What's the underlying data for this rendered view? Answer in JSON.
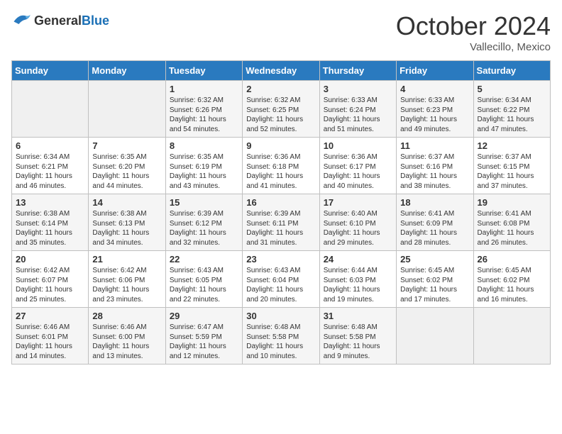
{
  "header": {
    "logo_general": "General",
    "logo_blue": "Blue",
    "month": "October 2024",
    "location": "Vallecillo, Mexico"
  },
  "days_of_week": [
    "Sunday",
    "Monday",
    "Tuesday",
    "Wednesday",
    "Thursday",
    "Friday",
    "Saturday"
  ],
  "weeks": [
    [
      {
        "day": "",
        "empty": true
      },
      {
        "day": "",
        "empty": true
      },
      {
        "day": "1",
        "sunrise": "Sunrise: 6:32 AM",
        "sunset": "Sunset: 6:26 PM",
        "daylight": "Daylight: 11 hours and 54 minutes."
      },
      {
        "day": "2",
        "sunrise": "Sunrise: 6:32 AM",
        "sunset": "Sunset: 6:25 PM",
        "daylight": "Daylight: 11 hours and 52 minutes."
      },
      {
        "day": "3",
        "sunrise": "Sunrise: 6:33 AM",
        "sunset": "Sunset: 6:24 PM",
        "daylight": "Daylight: 11 hours and 51 minutes."
      },
      {
        "day": "4",
        "sunrise": "Sunrise: 6:33 AM",
        "sunset": "Sunset: 6:23 PM",
        "daylight": "Daylight: 11 hours and 49 minutes."
      },
      {
        "day": "5",
        "sunrise": "Sunrise: 6:34 AM",
        "sunset": "Sunset: 6:22 PM",
        "daylight": "Daylight: 11 hours and 47 minutes."
      }
    ],
    [
      {
        "day": "6",
        "sunrise": "Sunrise: 6:34 AM",
        "sunset": "Sunset: 6:21 PM",
        "daylight": "Daylight: 11 hours and 46 minutes."
      },
      {
        "day": "7",
        "sunrise": "Sunrise: 6:35 AM",
        "sunset": "Sunset: 6:20 PM",
        "daylight": "Daylight: 11 hours and 44 minutes."
      },
      {
        "day": "8",
        "sunrise": "Sunrise: 6:35 AM",
        "sunset": "Sunset: 6:19 PM",
        "daylight": "Daylight: 11 hours and 43 minutes."
      },
      {
        "day": "9",
        "sunrise": "Sunrise: 6:36 AM",
        "sunset": "Sunset: 6:18 PM",
        "daylight": "Daylight: 11 hours and 41 minutes."
      },
      {
        "day": "10",
        "sunrise": "Sunrise: 6:36 AM",
        "sunset": "Sunset: 6:17 PM",
        "daylight": "Daylight: 11 hours and 40 minutes."
      },
      {
        "day": "11",
        "sunrise": "Sunrise: 6:37 AM",
        "sunset": "Sunset: 6:16 PM",
        "daylight": "Daylight: 11 hours and 38 minutes."
      },
      {
        "day": "12",
        "sunrise": "Sunrise: 6:37 AM",
        "sunset": "Sunset: 6:15 PM",
        "daylight": "Daylight: 11 hours and 37 minutes."
      }
    ],
    [
      {
        "day": "13",
        "sunrise": "Sunrise: 6:38 AM",
        "sunset": "Sunset: 6:14 PM",
        "daylight": "Daylight: 11 hours and 35 minutes."
      },
      {
        "day": "14",
        "sunrise": "Sunrise: 6:38 AM",
        "sunset": "Sunset: 6:13 PM",
        "daylight": "Daylight: 11 hours and 34 minutes."
      },
      {
        "day": "15",
        "sunrise": "Sunrise: 6:39 AM",
        "sunset": "Sunset: 6:12 PM",
        "daylight": "Daylight: 11 hours and 32 minutes."
      },
      {
        "day": "16",
        "sunrise": "Sunrise: 6:39 AM",
        "sunset": "Sunset: 6:11 PM",
        "daylight": "Daylight: 11 hours and 31 minutes."
      },
      {
        "day": "17",
        "sunrise": "Sunrise: 6:40 AM",
        "sunset": "Sunset: 6:10 PM",
        "daylight": "Daylight: 11 hours and 29 minutes."
      },
      {
        "day": "18",
        "sunrise": "Sunrise: 6:41 AM",
        "sunset": "Sunset: 6:09 PM",
        "daylight": "Daylight: 11 hours and 28 minutes."
      },
      {
        "day": "19",
        "sunrise": "Sunrise: 6:41 AM",
        "sunset": "Sunset: 6:08 PM",
        "daylight": "Daylight: 11 hours and 26 minutes."
      }
    ],
    [
      {
        "day": "20",
        "sunrise": "Sunrise: 6:42 AM",
        "sunset": "Sunset: 6:07 PM",
        "daylight": "Daylight: 11 hours and 25 minutes."
      },
      {
        "day": "21",
        "sunrise": "Sunrise: 6:42 AM",
        "sunset": "Sunset: 6:06 PM",
        "daylight": "Daylight: 11 hours and 23 minutes."
      },
      {
        "day": "22",
        "sunrise": "Sunrise: 6:43 AM",
        "sunset": "Sunset: 6:05 PM",
        "daylight": "Daylight: 11 hours and 22 minutes."
      },
      {
        "day": "23",
        "sunrise": "Sunrise: 6:43 AM",
        "sunset": "Sunset: 6:04 PM",
        "daylight": "Daylight: 11 hours and 20 minutes."
      },
      {
        "day": "24",
        "sunrise": "Sunrise: 6:44 AM",
        "sunset": "Sunset: 6:03 PM",
        "daylight": "Daylight: 11 hours and 19 minutes."
      },
      {
        "day": "25",
        "sunrise": "Sunrise: 6:45 AM",
        "sunset": "Sunset: 6:02 PM",
        "daylight": "Daylight: 11 hours and 17 minutes."
      },
      {
        "day": "26",
        "sunrise": "Sunrise: 6:45 AM",
        "sunset": "Sunset: 6:02 PM",
        "daylight": "Daylight: 11 hours and 16 minutes."
      }
    ],
    [
      {
        "day": "27",
        "sunrise": "Sunrise: 6:46 AM",
        "sunset": "Sunset: 6:01 PM",
        "daylight": "Daylight: 11 hours and 14 minutes."
      },
      {
        "day": "28",
        "sunrise": "Sunrise: 6:46 AM",
        "sunset": "Sunset: 6:00 PM",
        "daylight": "Daylight: 11 hours and 13 minutes."
      },
      {
        "day": "29",
        "sunrise": "Sunrise: 6:47 AM",
        "sunset": "Sunset: 5:59 PM",
        "daylight": "Daylight: 11 hours and 12 minutes."
      },
      {
        "day": "30",
        "sunrise": "Sunrise: 6:48 AM",
        "sunset": "Sunset: 5:58 PM",
        "daylight": "Daylight: 11 hours and 10 minutes."
      },
      {
        "day": "31",
        "sunrise": "Sunrise: 6:48 AM",
        "sunset": "Sunset: 5:58 PM",
        "daylight": "Daylight: 11 hours and 9 minutes."
      },
      {
        "day": "",
        "empty": true
      },
      {
        "day": "",
        "empty": true
      }
    ]
  ]
}
